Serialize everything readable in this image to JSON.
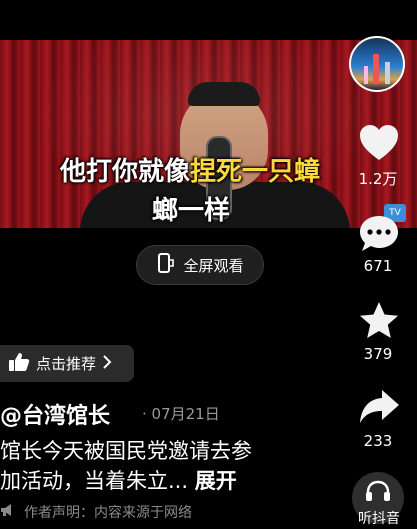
{
  "video": {
    "caption_line1_white": "他打你就像",
    "caption_line1_yellow": "捏死一只蟑",
    "caption_line2_white": "螂一样"
  },
  "fullscreen": {
    "label": "全屏观看",
    "icon": "fullscreen-phone-icon"
  },
  "side_rail": {
    "likes": "1.2万",
    "comments": "671",
    "favorites": "379",
    "shares": "233",
    "listen_label": "听抖音"
  },
  "post": {
    "recommend_label": "点击推荐",
    "author": "@台湾馆长",
    "date": "· 07月21日",
    "description_line1": "馆长今天被国民党邀请去参",
    "description_line2": "加活动，当着朱立...",
    "expand_label": "展开",
    "notice": "作者声明：内容来源于网络"
  },
  "colors": {
    "caption_highlight": "#ffd83b",
    "background": "#000000"
  }
}
